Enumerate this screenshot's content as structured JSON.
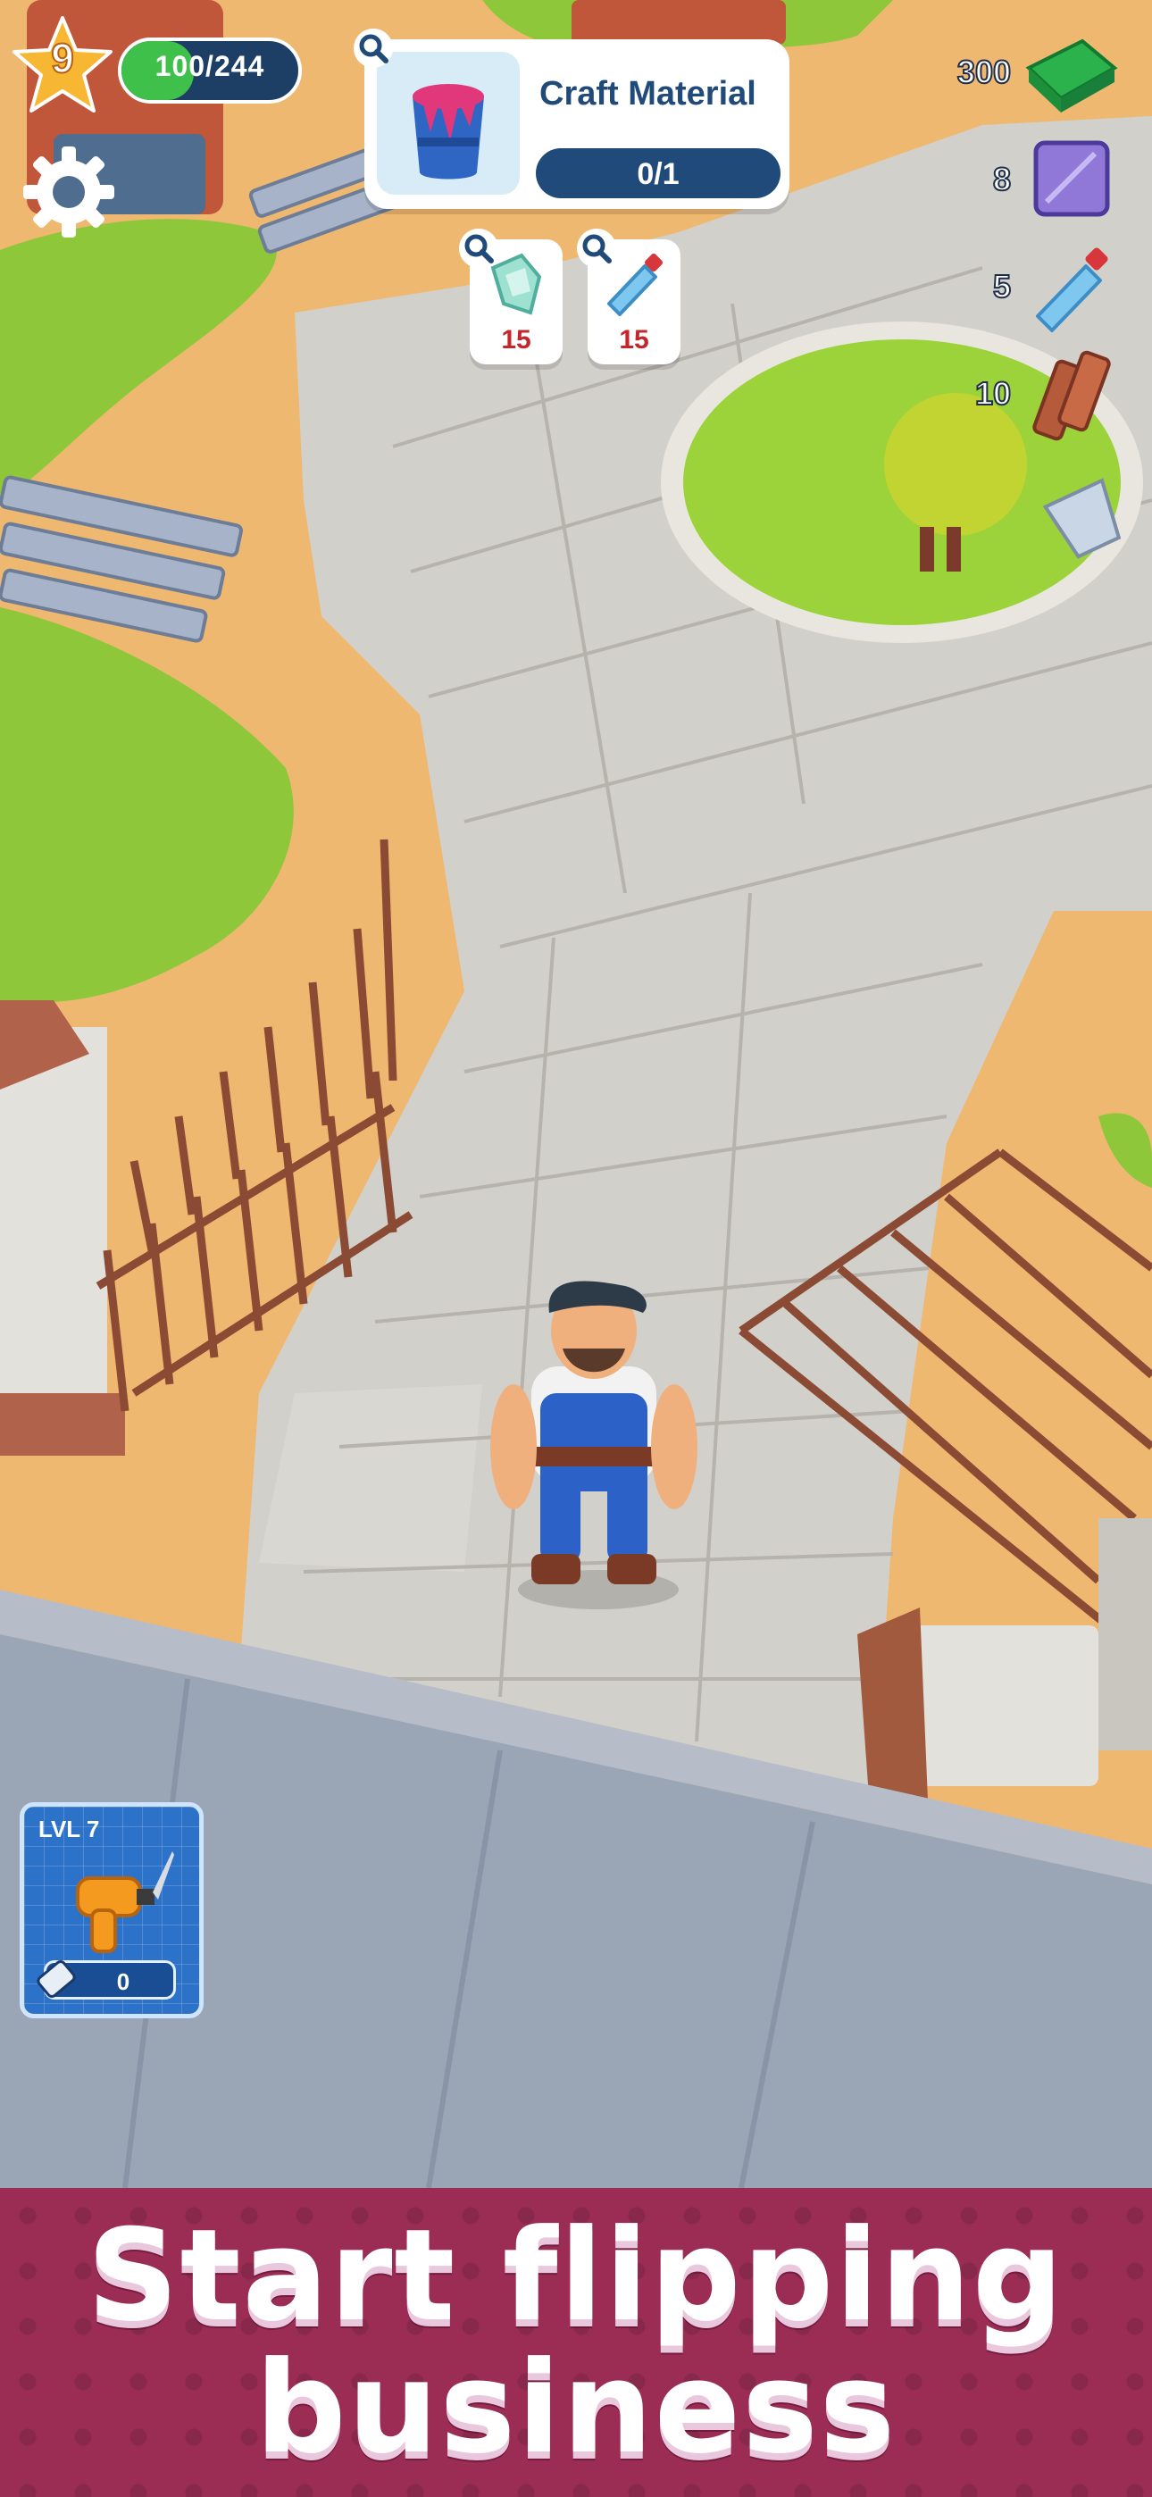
{
  "hud": {
    "player_level": "9",
    "xp_text": "100/244",
    "xp_progress": 0.41
  },
  "task": {
    "title": "Craft Material",
    "progress_text": "0/1",
    "requirements": [
      {
        "name": "glass-shards",
        "count": "15"
      },
      {
        "name": "plastic-bottles",
        "count": "15"
      }
    ]
  },
  "resources": [
    {
      "name": "cash",
      "value": "300"
    },
    {
      "name": "metal-plate",
      "value": "8"
    },
    {
      "name": "plastic-bottles",
      "value": "5"
    },
    {
      "name": "wood-planks",
      "value": "10"
    }
  ],
  "tool": {
    "level_label": "LVL 7",
    "energy_value": "0"
  },
  "banner": {
    "line1": "Start flipping",
    "line2": "business"
  },
  "colors": {
    "sand": "#efb870",
    "grass": "#8fc73a",
    "stone": "#d2d0cb",
    "wall": "#9aa6b6",
    "banner": "#9b2d55",
    "hud_blue": "#1f4a7a"
  }
}
